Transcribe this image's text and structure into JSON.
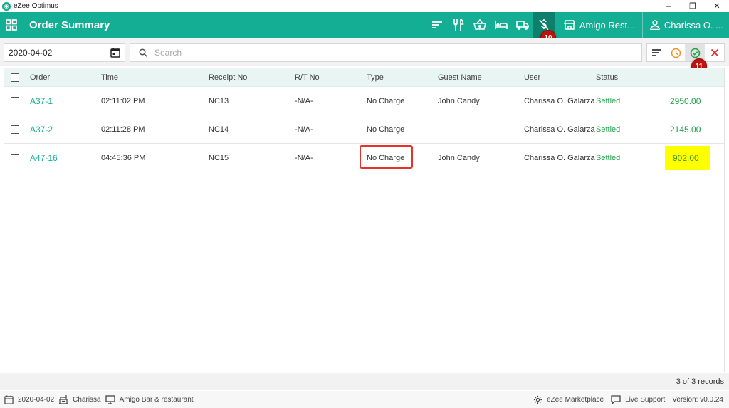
{
  "window": {
    "title": "eZee Optimus"
  },
  "header": {
    "title": "Order Summary",
    "outlet_label": "Amigo Rest...",
    "user_label": "Charissa O. ..."
  },
  "filters": {
    "date": "2020-04-02",
    "search_placeholder": "Search"
  },
  "callouts": {
    "badge_10": "10",
    "badge_11": "11"
  },
  "table": {
    "headers": {
      "order": "Order",
      "time": "Time",
      "receipt": "Receipt No",
      "rt": "R/T No",
      "type": "Type",
      "guest": "Guest Name",
      "user": "User",
      "status": "Status"
    },
    "rows": [
      {
        "order": "A37-1",
        "time": "02:11:02 PM",
        "receipt": "NC13",
        "rt": "-N/A-",
        "type": "No Charge",
        "guest": "John Candy",
        "user": "Charissa O. Galarza",
        "status": "Settled",
        "amount": "2950.00"
      },
      {
        "order": "A37-2",
        "time": "02:11:28 PM",
        "receipt": "NC14",
        "rt": "-N/A-",
        "type": "No Charge",
        "guest": "",
        "user": "Charissa O. Galarza",
        "status": "Settled",
        "amount": "2145.00"
      },
      {
        "order": "A47-16",
        "time": "04:45:36 PM",
        "receipt": "NC15",
        "rt": "-N/A-",
        "type": "No Charge",
        "guest": "John Candy",
        "user": "Charissa O. Galarza",
        "status": "Settled",
        "amount": "902.00"
      }
    ]
  },
  "records": "3 of 3 records",
  "statusbar": {
    "date": "2020-04-02",
    "user": "Charissa",
    "outlet": "Amigo Bar & restaurant",
    "marketplace": "eZee Marketplace",
    "support": "Live Support",
    "version": "Version: v0.0.24"
  },
  "colors": {
    "header": "#14ae95",
    "header_active": "#0e7f6c",
    "link": "#14ae95",
    "settled": "#1fa24a",
    "highlight": "#ffff00",
    "callout": "#c0120c",
    "annotation_box": "#e5322b"
  }
}
